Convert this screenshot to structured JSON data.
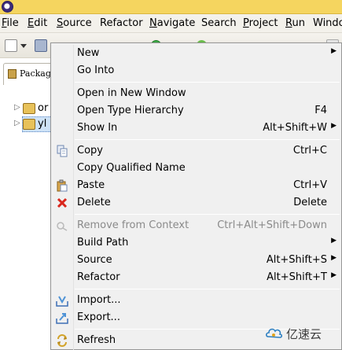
{
  "menubar": {
    "items": [
      {
        "label": "File",
        "mnemonic": "F",
        "rest": "ile"
      },
      {
        "label": "Edit",
        "mnemonic": "E",
        "rest": "dit"
      },
      {
        "label": "Source",
        "mnemonic": "S",
        "rest": "ource"
      },
      {
        "label": "Refactor",
        "mnemonic": "",
        "rest": "Refactor"
      },
      {
        "label": "Navigate",
        "mnemonic": "N",
        "rest": "avigate"
      },
      {
        "label": "Search",
        "mnemonic": "",
        "rest": "Search"
      },
      {
        "label": "Project",
        "mnemonic": "P",
        "rest": "roject"
      },
      {
        "label": "Run",
        "mnemonic": "R",
        "rest": "un"
      },
      {
        "label": "Windo",
        "mnemonic": "",
        "rest": "Windo"
      }
    ]
  },
  "explorer": {
    "tab_label": "Packag",
    "tree": [
      {
        "label": "or",
        "selected": false
      },
      {
        "label": "yl",
        "selected": true
      }
    ]
  },
  "context_menu": {
    "items": [
      {
        "label": "New",
        "shortcut": "",
        "submenu": true,
        "icon": "",
        "disabled": false
      },
      {
        "label": "Go Into",
        "shortcut": "",
        "submenu": false,
        "icon": "",
        "disabled": false
      },
      {
        "label": "Open in New Window",
        "shortcut": "",
        "submenu": false,
        "icon": "",
        "disabled": false
      },
      {
        "label": "Open Type Hierarchy",
        "shortcut": "F4",
        "submenu": false,
        "icon": "",
        "disabled": false
      },
      {
        "label": "Show In",
        "shortcut": "Alt+Shift+W",
        "submenu": true,
        "icon": "",
        "disabled": false
      },
      {
        "label": "Copy",
        "shortcut": "Ctrl+C",
        "submenu": false,
        "icon": "copy-icon",
        "disabled": false
      },
      {
        "label": "Copy Qualified Name",
        "shortcut": "",
        "submenu": false,
        "icon": "",
        "disabled": false
      },
      {
        "label": "Paste",
        "shortcut": "Ctrl+V",
        "submenu": false,
        "icon": "paste-icon",
        "disabled": false
      },
      {
        "label": "Delete",
        "shortcut": "Delete",
        "submenu": false,
        "icon": "delete-icon",
        "disabled": false
      },
      {
        "label": "Remove from Context",
        "shortcut": "Ctrl+Alt+Shift+Down",
        "submenu": false,
        "icon": "remove-context-icon",
        "disabled": true
      },
      {
        "label": "Build Path",
        "shortcut": "",
        "submenu": true,
        "icon": "",
        "disabled": false
      },
      {
        "label": "Source",
        "shortcut": "Alt+Shift+S",
        "submenu": true,
        "icon": "",
        "disabled": false
      },
      {
        "label": "Refactor",
        "shortcut": "Alt+Shift+T",
        "submenu": true,
        "icon": "",
        "disabled": false
      },
      {
        "label": "Import...",
        "shortcut": "",
        "submenu": false,
        "icon": "import-icon",
        "disabled": false
      },
      {
        "label": "Export...",
        "shortcut": "",
        "submenu": false,
        "icon": "export-icon",
        "disabled": false
      },
      {
        "label": "Refresh",
        "shortcut": "",
        "submenu": false,
        "icon": "refresh-icon",
        "disabled": false
      }
    ]
  },
  "watermark": {
    "text": "亿速云"
  },
  "colors": {
    "titlebar": "#f5d55f",
    "menu_bg": "#f0f0f0",
    "selection": "#cfe3f7",
    "delete_red": "#d9261c"
  }
}
